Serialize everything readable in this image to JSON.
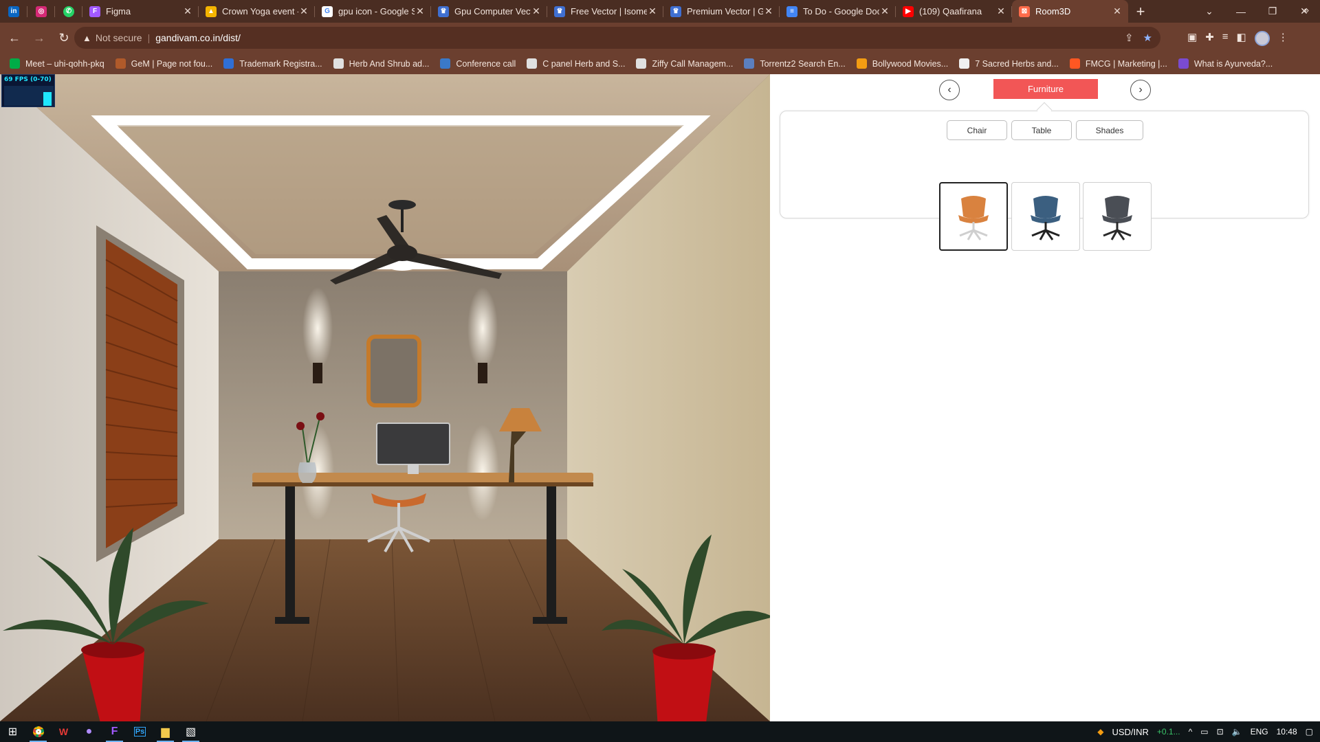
{
  "browser": {
    "pinned_tabs": [
      {
        "name": "linkedin",
        "glyph": "in",
        "color": "#0a66c2"
      },
      {
        "name": "instagram",
        "glyph": "◎",
        "color": "#d62976"
      },
      {
        "name": "whatsapp",
        "glyph": "✆",
        "color": "#25d366"
      }
    ],
    "tabs": [
      {
        "title": "Figma",
        "fav": "figma-icon",
        "fav_color": "#a259ff",
        "glyph": "F"
      },
      {
        "title": "Crown Yoga event -",
        "fav": "google-drive-icon",
        "fav_color": "#f4b400",
        "glyph": "▲"
      },
      {
        "title": "gpu icon - Google S",
        "fav": "google-icon",
        "fav_color": "#ffffff",
        "glyph": "G"
      },
      {
        "title": "Gpu Computer Vect",
        "fav": "vector-site-icon",
        "fav_color": "#3f6fd1",
        "glyph": "♛"
      },
      {
        "title": "Free Vector | Isome",
        "fav": "vector-site-icon",
        "fav_color": "#3f6fd1",
        "glyph": "♛"
      },
      {
        "title": "Premium Vector | G",
        "fav": "vector-site-icon",
        "fav_color": "#3f6fd1",
        "glyph": "♛"
      },
      {
        "title": "To Do - Google Doc",
        "fav": "google-docs-icon",
        "fav_color": "#4285f4",
        "glyph": "≡"
      },
      {
        "title": "(109) Qaafirana",
        "fav": "youtube-icon",
        "fav_color": "#ff0000",
        "glyph": "▶"
      },
      {
        "title": "Room3D",
        "fav": "room3d-icon",
        "fav_color": "#ff6b4a",
        "glyph": "⊠",
        "active": true
      }
    ],
    "new_tab": "+",
    "address": {
      "warning": "▲",
      "security": "Not secure",
      "url": "gandivam.co.in/dist/"
    },
    "bookmarks": [
      {
        "label": "Meet – uhi-qohh-pkq",
        "color": "#00ac47"
      },
      {
        "label": "GeM | Page not fou...",
        "color": "#b05a2a"
      },
      {
        "label": "Trademark Registra...",
        "color": "#2f6fd6"
      },
      {
        "label": "Herb And Shrub ad...",
        "color": "#e0e0e0"
      },
      {
        "label": "Conference call",
        "color": "#3a79c9"
      },
      {
        "label": "C panel Herb and S...",
        "color": "#e0e0e0"
      },
      {
        "label": "Ziffy Call Managem...",
        "color": "#e0e0e0"
      },
      {
        "label": "Torrentz2 Search En...",
        "color": "#5b7fbf"
      },
      {
        "label": "Bollywood Movies...",
        "color": "#f39c12"
      },
      {
        "label": "7 Sacred Herbs and...",
        "color": "#f0f0f0"
      },
      {
        "label": "FMCG | Marketing |...",
        "color": "#ff5722"
      },
      {
        "label": "What is Ayurveda?...",
        "color": "#7a4bd0"
      }
    ]
  },
  "fps": {
    "label": "69 FPS (0-70)"
  },
  "panel": {
    "category": "Furniture",
    "prev": "‹",
    "next": "›",
    "subtabs": [
      "Chair",
      "Table",
      "Shades"
    ],
    "items": [
      {
        "name": "orange-chair",
        "seat": "#d9823f",
        "base": "#cfcfcf",
        "selected": true
      },
      {
        "name": "blue-office-chair",
        "seat": "#3b5f80",
        "base": "#222222",
        "selected": false
      },
      {
        "name": "grey-mesh-chair",
        "seat": "#4a4e55",
        "base": "#2a2a2a",
        "selected": false
      }
    ]
  },
  "taskbar": {
    "tray": {
      "ticker": "USD/INR",
      "change": "+0.1...",
      "lang": "ENG",
      "time": "10:48"
    }
  }
}
